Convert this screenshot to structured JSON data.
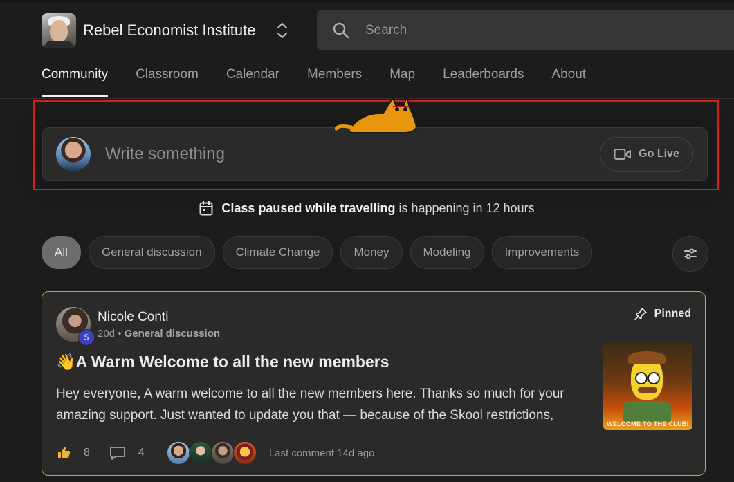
{
  "header": {
    "brand_name": "Rebel Economist Institute",
    "search_placeholder": "Search"
  },
  "nav": {
    "tabs": [
      {
        "label": "Community",
        "active": true
      },
      {
        "label": "Classroom"
      },
      {
        "label": "Calendar"
      },
      {
        "label": "Members"
      },
      {
        "label": "Map"
      },
      {
        "label": "Leaderboards"
      },
      {
        "label": "About"
      }
    ]
  },
  "composer": {
    "placeholder": "Write something",
    "go_live_label": "Go Live"
  },
  "event": {
    "name": "Class paused while travelling",
    "suffix": "is happening in 12 hours"
  },
  "filters": {
    "chips": [
      "All",
      "General discussion",
      "Climate Change",
      "Money",
      "Modeling",
      "Improvements"
    ]
  },
  "post": {
    "author": "Nicole Conti",
    "level": "5",
    "age": "20d",
    "separator": "•",
    "category": "General discussion",
    "pinned_label": "Pinned",
    "title": "👋A Warm Welcome to all the new members",
    "body": "Hey everyone, A warm welcome to all the new members here. Thanks so much for your amazing support. Just wanted to update you that — because of the Skool restrictions,",
    "thumbnail_caption": "WELCOME TO THE CLUB!",
    "likes": "8",
    "comments": "4",
    "last_comment": "Last comment 14d ago"
  },
  "colors": {
    "accent_border": "#c8a34a",
    "highlight": "#d31f1f",
    "level_badge": "#3b41c4"
  }
}
